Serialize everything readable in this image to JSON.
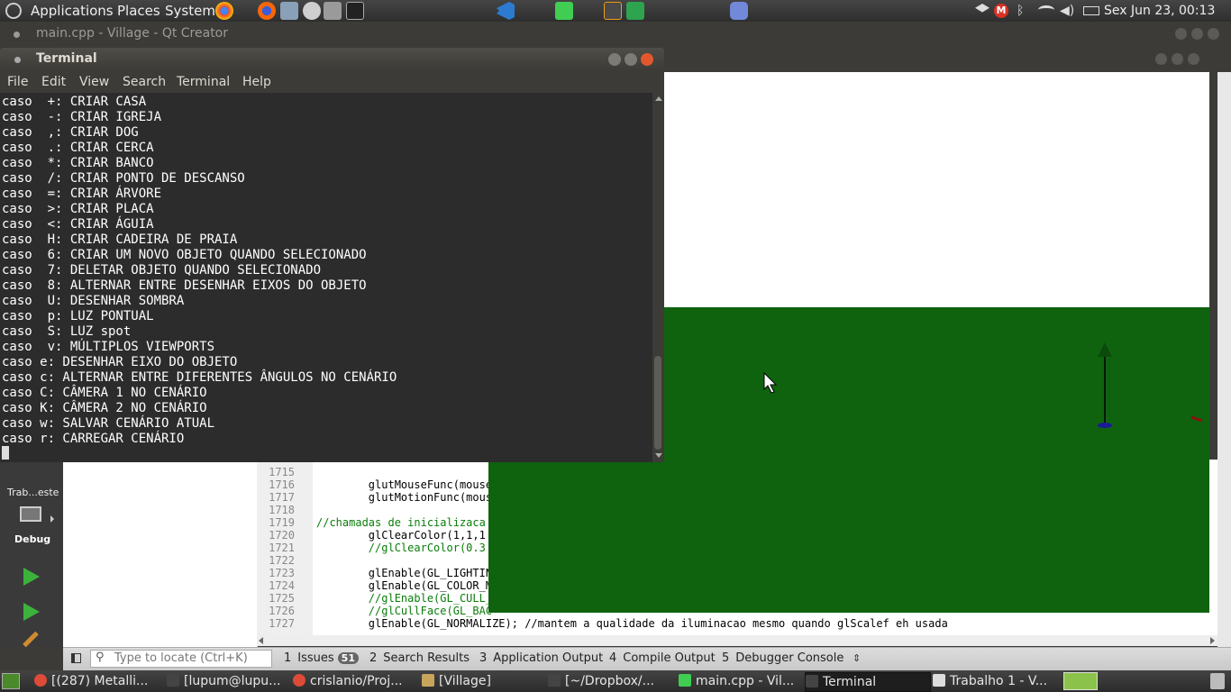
{
  "top_panel": {
    "menus": [
      "Applications",
      "Places",
      "System"
    ],
    "clock": "Sex Jun 23, 00:13"
  },
  "qt_window": {
    "title": "main.cpp - Village - Qt Creator",
    "mode_label": "Trab...este",
    "debug_label": "Debug",
    "locator_placeholder": "Type to locate (Ctrl+K)",
    "bottom_tabs": [
      {
        "num": "1",
        "label": "Issues",
        "badge": "51"
      },
      {
        "num": "2",
        "label": "Search Results"
      },
      {
        "num": "3",
        "label": "Application Output"
      },
      {
        "num": "4",
        "label": "Compile Output"
      },
      {
        "num": "5",
        "label": "Debugger Console"
      }
    ],
    "code_lines": [
      {
        "num": "1715",
        "text": ""
      },
      {
        "num": "1716",
        "text": "        glutMouseFunc(mouse"
      },
      {
        "num": "1717",
        "text": "        glutMotionFunc(mous"
      },
      {
        "num": "1718",
        "text": ""
      },
      {
        "num": "1719",
        "text": "//chamadas de inicializaca"
      },
      {
        "num": "1720",
        "text": "        glClearColor(1,1,1"
      },
      {
        "num": "1721",
        "text": "        //glClearColor(0.3"
      },
      {
        "num": "1722",
        "text": ""
      },
      {
        "num": "1723",
        "text": "        glEnable(GL_LIGHTIN"
      },
      {
        "num": "1724",
        "text": "        glEnable(GL_COLOR_M"
      },
      {
        "num": "1725",
        "text": "        //glEnable(GL_CULL_"
      },
      {
        "num": "1726",
        "text": "        //glCullFace(GL_BAC"
      },
      {
        "num": "1727",
        "text": "        glEnable(GL_NORMALIZE); //mantem a qualidade da iluminacao mesmo quando glScalef eh usada"
      }
    ]
  },
  "terminal": {
    "title": "Terminal",
    "menu": [
      "File",
      "Edit",
      "View",
      "Search",
      "Terminal",
      "Help"
    ],
    "lines": [
      "caso  +: CRIAR CASA",
      "caso  -: CRIAR IGREJA",
      "caso  ,: CRIAR DOG",
      "caso  .: CRIAR CERCA",
      "caso  *: CRIAR BANCO",
      "caso  /: CRIAR PONTO DE DESCANSO",
      "caso  =: CRIAR ÁRVORE",
      "caso  >: CRIAR PLACA",
      "caso  <: CRIAR ÁGUIA",
      "caso  H: CRIAR CADEIRA DE PRAIA",
      "caso  6: CRIAR UM NOVO OBJETO QUANDO SELECIONADO",
      "caso  7: DELETAR OBJETO QUANDO SELECIONADO",
      "caso  8: ALTERNAR ENTRE DESENHAR EIXOS DO OBJETO",
      "caso  U: DESENHAR SOMBRA",
      "caso  p: LUZ PONTUAL",
      "caso  S: LUZ spot",
      "caso  v: MÚLTIPLOS VIEWPORTS",
      "caso e: DESENHAR EIXO DO OBJETO",
      "caso c: ALTERNAR ENTRE DIFERENTES ÂNGULOS NO CENÁRIO",
      "caso C: CÂMERA 1 NO CENÁRIO",
      "caso K: CÂMERA 2 NO CENÁRIO",
      "caso w: SALVAR CENÁRIO ATUAL",
      "caso r: CARREGAR CENÁRIO"
    ]
  },
  "gl_window": {
    "sky_color": "#ffffff",
    "ground_color": "#0f630f"
  },
  "taskbar": {
    "tasks": [
      {
        "label": "[(287) Metalli...",
        "icon": "chrome-icon",
        "color": "#dd4b39"
      },
      {
        "label": "[lupum@lupu...",
        "icon": "terminal-icon",
        "color": "#444444"
      },
      {
        "label": "crislanio/Proj...",
        "icon": "chrome-icon",
        "color": "#dd4b39"
      },
      {
        "label": "[Village]",
        "icon": "folder-icon",
        "color": "#c9a55b"
      },
      {
        "label": "[~/Dropbox/...",
        "icon": "terminal-icon",
        "color": "#444444"
      },
      {
        "label": "main.cpp - Vil...",
        "icon": "qt-icon",
        "color": "#41cd52"
      },
      {
        "label": "Terminal",
        "icon": "terminal-icon",
        "color": "#444444",
        "active": true
      },
      {
        "label": "Trabalho 1 - V...",
        "icon": "window-icon",
        "color": "#dddddd"
      }
    ]
  }
}
